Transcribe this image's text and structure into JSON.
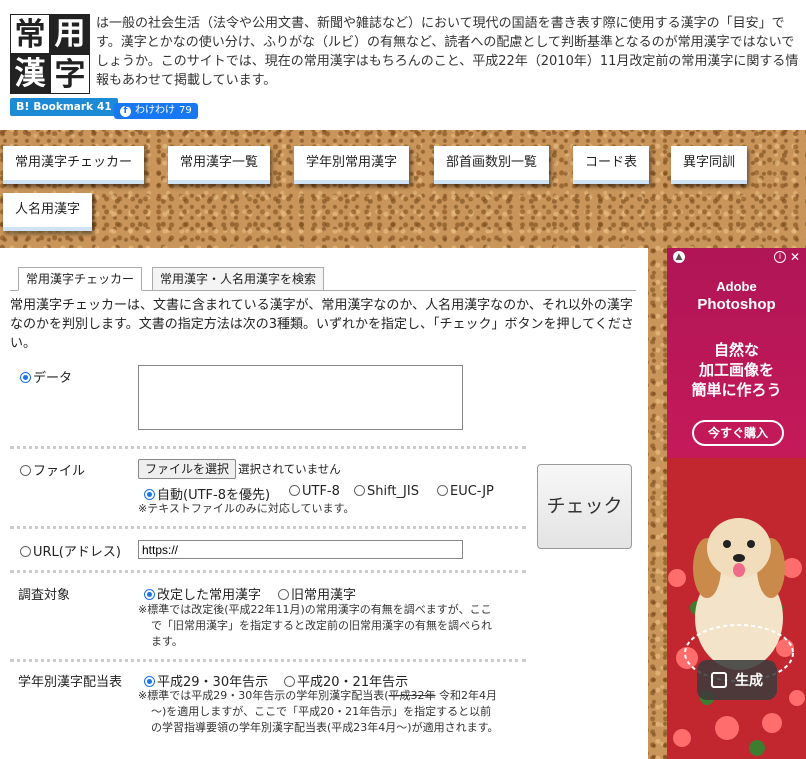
{
  "header": {
    "logo_chars": [
      "常",
      "用",
      "漢",
      "字"
    ],
    "intro": "は一般の社会生活（法令や公用文書、新聞や雑誌など）において現代の国語を書き表す際に使用する漢字の「目安」です。漢字とかなの使い分け、ふりがな（ルビ）の有無など、読者への配慮として判断基準となるのが常用漢字ではないでしょうか。このサイトでは、現在の常用漢字はもちろんのこと、平成22年（2010年）11月改定前の常用漢字に関する情報もあわせて掲載しています。",
    "bookmark_label": "Bookmark",
    "bookmark_b": "B!",
    "bookmark_count": "41",
    "share_label": "わけわけ",
    "share_count": "79"
  },
  "nav": [
    {
      "label": "常用漢字チェッカー"
    },
    {
      "label": "常用漢字一覧"
    },
    {
      "label": "学年別常用漢字"
    },
    {
      "label": "部首画数別一覧"
    },
    {
      "label": "コード表"
    },
    {
      "label": "異字同訓"
    },
    {
      "label": "人名用漢字"
    }
  ],
  "tabs": [
    {
      "label": "常用漢字チェッカー",
      "active": true
    },
    {
      "label": "常用漢字・人名用漢字を検索",
      "active": false
    }
  ],
  "description": "常用漢字チェッカーは、文書に含まれている漢字が、常用漢字なのか、人名用漢字なのか、それ以外の漢字なのかを判別します。文書の指定方法は次の3種類。いずれかを指定し、「チェック」ボタンを押してください。",
  "form": {
    "data_label": "データ",
    "data_value": "",
    "file_label": "ファイル",
    "file_button": "ファイルを選択",
    "file_status": "選択されていません",
    "encodings": [
      {
        "label": "自動(UTF-8を優先)",
        "selected": true
      },
      {
        "label": "UTF-8",
        "selected": false
      },
      {
        "label": "Shift_JIS",
        "selected": false
      },
      {
        "label": "EUC-JP",
        "selected": false
      }
    ],
    "file_note": "※テキストファイルのみに対応しています。",
    "url_label": "URL(アドレス)",
    "url_value": "https://",
    "target_label": "調査対象",
    "target_options": [
      {
        "label": "改定した常用漢字",
        "selected": true
      },
      {
        "label": "旧常用漢字",
        "selected": false
      }
    ],
    "target_note_1": "※標準では改定後(平成22年11月)の常用漢字の有無を調べますが、ここ",
    "target_note_2": "で「旧常用漢字」を指定すると改定前の旧常用漢字の有無を調べられ",
    "target_note_3": "ます。",
    "grade_label": "学年別漢字配当表",
    "grade_options": [
      {
        "label": "平成29・30年告示",
        "selected": true
      },
      {
        "label": "平成20・21年告示",
        "selected": false
      }
    ],
    "grade_note_1a": "※標準では平成29・30年告示の学年別漢字配当表(",
    "grade_note_1strike": "平成32年",
    "grade_note_1b": " 令和2年4月",
    "grade_note_2": "～)を適用しますが、ここで「平成20・21年告示」を指定すると以前",
    "grade_note_3": "の学習指導要領の学年別漢字配当表(平成23年4月～)が適用されます。",
    "check_button": "チェック"
  },
  "ad": {
    "brand_line1": "Adobe",
    "brand_line2": "Photoshop",
    "copy_line1": "自然な",
    "copy_line2": "加工画像を",
    "copy_line3": "簡単に作ろう",
    "cta": "今すぐ購入",
    "generate": "生成",
    "colors": {
      "bg": "#c71a5a",
      "text": "#ffffff"
    }
  },
  "colors": {
    "accent": "#1a73e8",
    "nav_underline": "#cfe3f4"
  }
}
